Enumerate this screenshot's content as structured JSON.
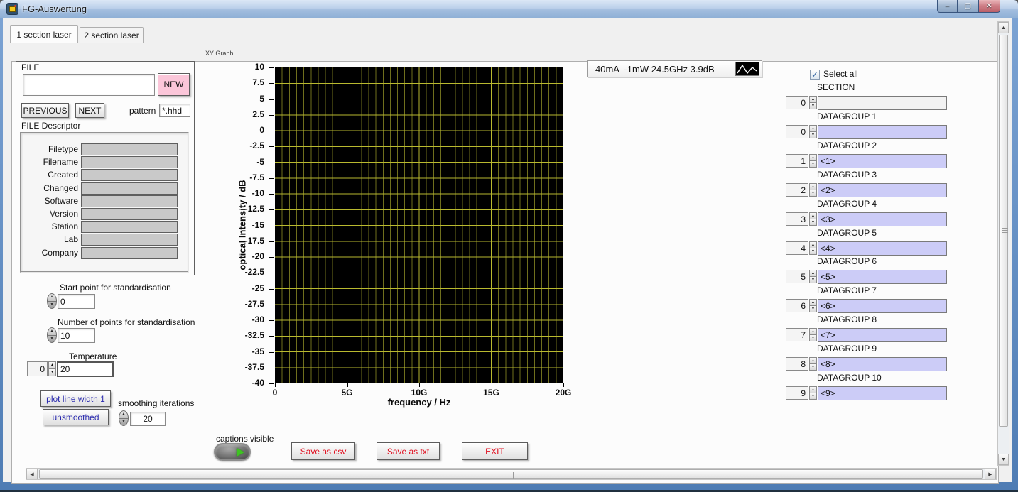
{
  "window": {
    "title": "FG-Auswertung"
  },
  "icons": {
    "minimize": "–",
    "maximize": "▢",
    "close": "✕",
    "check": "✓",
    "up": "▲",
    "down": "▼",
    "left": "◀",
    "right": "▶"
  },
  "tabs": [
    {
      "label": "1 section laser"
    },
    {
      "label": "2 section laser"
    }
  ],
  "file_panel": {
    "group_label": "FILE",
    "file_input_value": "",
    "new_button": "NEW",
    "previous_button": "PREVIOUS",
    "next_button": "NEXT",
    "pattern_label": "pattern",
    "pattern_value": "*.hhd",
    "descriptor_label": "FILE Descriptor",
    "descriptor_fields": [
      "Filetype",
      "Filename",
      "Created",
      "Changed",
      "Software",
      "Version",
      "Station",
      "Lab",
      "Company"
    ],
    "descriptor_values": [
      "",
      "",
      "",
      "",
      "",
      "",
      "",
      "",
      ""
    ]
  },
  "standardisation": {
    "start_label": "Start point for standardisation",
    "start_value": "0",
    "points_label": "Number of points for standardisation",
    "points_value": "10",
    "temperature_label": "Temperature",
    "temperature_index": "0",
    "temperature_value": "20",
    "plot_line_width_button": "plot line width 1",
    "unsmoothed_button": "unsmoothed",
    "smoothing_label": "smoothing iterations",
    "smoothing_value": "20"
  },
  "graph": {
    "label": "XY Graph",
    "y_axis_title": "optical Intensity / dB",
    "x_axis_title": "frequency / Hz",
    "y_ticks": [
      "10",
      "7.5",
      "5",
      "2.5",
      "0",
      "-2.5",
      "-5",
      "-7.5",
      "-10",
      "-12.5",
      "-15",
      "-17.5",
      "-20",
      "-22.5",
      "-25",
      "-27.5",
      "-30",
      "-32.5",
      "-35",
      "-37.5",
      "-40"
    ],
    "x_ticks": [
      "0",
      "5G",
      "10G",
      "15G",
      "20G"
    ],
    "x_divisions": 40,
    "x_major_every": 10,
    "y_divisions": 20,
    "legend_text": "40mA  -1mW 24.5GHz 3.9dB"
  },
  "selection": {
    "select_all_label": "Select all",
    "select_all_checked": true,
    "groups": [
      {
        "label": "SECTION",
        "index": "0",
        "value": "",
        "kind": "section"
      },
      {
        "label": "DATAGROUP 1",
        "index": "0",
        "value": ""
      },
      {
        "label": "DATAGROUP 2",
        "index": "1",
        "value": "<1>"
      },
      {
        "label": "DATAGROUP 3",
        "index": "2",
        "value": "<2>"
      },
      {
        "label": "DATAGROUP 4",
        "index": "3",
        "value": "<3>"
      },
      {
        "label": "DATAGROUP 5",
        "index": "4",
        "value": "<4>"
      },
      {
        "label": "DATAGROUP 6",
        "index": "5",
        "value": "<5>"
      },
      {
        "label": "DATAGROUP 7",
        "index": "6",
        "value": "<6>"
      },
      {
        "label": "DATAGROUP 8",
        "index": "7",
        "value": "<7>"
      },
      {
        "label": "DATAGROUP 9",
        "index": "8",
        "value": "<8>"
      },
      {
        "label": "DATAGROUP 10",
        "index": "9",
        "value": "<9>"
      }
    ]
  },
  "footer": {
    "captions_label": "captions visible",
    "save_csv_label": "Save as csv",
    "save_txt_label": "Save as txt",
    "exit_label": "EXIT"
  },
  "colors": {
    "new_button_pink": "#fbc6d9",
    "datagroup_field": "#ccccf7",
    "grid_minor": "#6f6f1d",
    "grid_major": "#b9b92f",
    "button_text_red": "#e01020",
    "button_text_blue": "#2a2aae",
    "led_green": "#3ec321",
    "plot_background": "#000000"
  }
}
